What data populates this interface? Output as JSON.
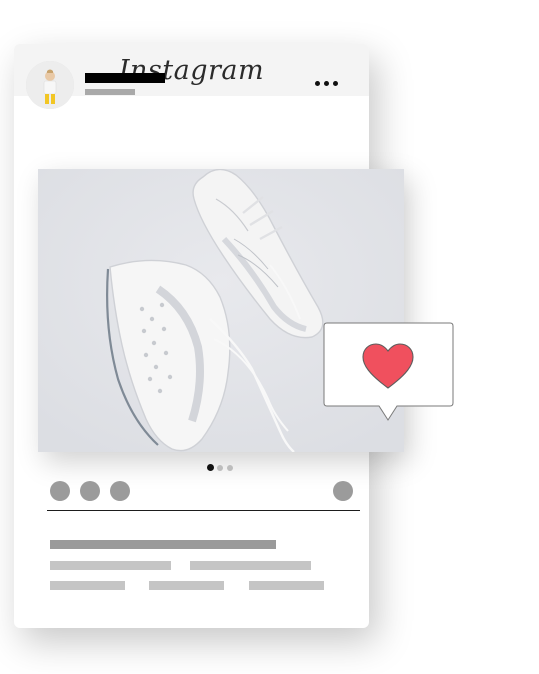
{
  "app": {
    "brand": "Instagram"
  },
  "post": {
    "carousel": {
      "current": 1,
      "total": 3
    }
  },
  "colors": {
    "header_bg": "#f4f4f4",
    "name_placeholder": "#000000",
    "sub_placeholder": "#a9a9a9",
    "action_placeholder": "#9b9b9b",
    "line_primary": "#9a9a9a",
    "line_secondary": "#c5c5c5",
    "heart": "#f0505e",
    "pager_active": "#111111",
    "pager_inactive": "#bdbdbd"
  },
  "icons": {
    "more": "more-horizontal-icon",
    "like": "heart-icon"
  }
}
